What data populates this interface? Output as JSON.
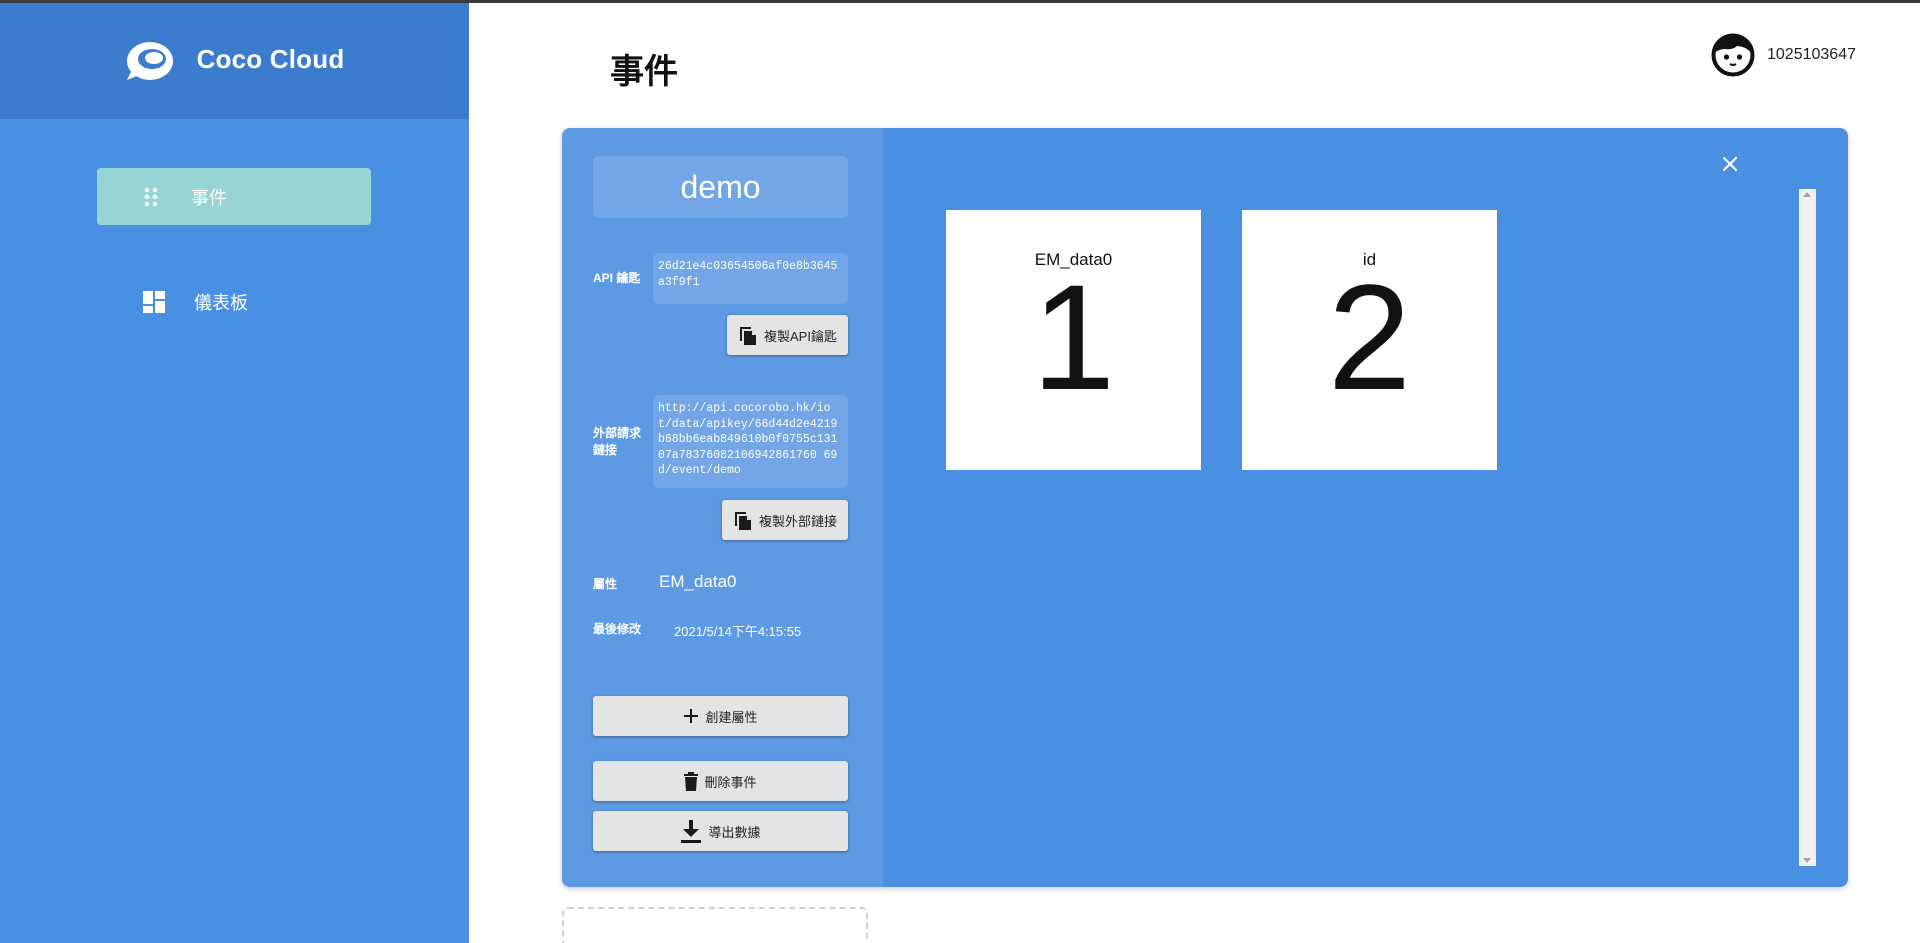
{
  "app": {
    "name": "Coco Cloud"
  },
  "sidebar": {
    "items": [
      {
        "label": "事件",
        "icon": "drag-dots-icon",
        "active": true
      },
      {
        "label": "儀表板",
        "icon": "dashboard-icon",
        "active": false
      }
    ]
  },
  "header": {
    "title": "事件",
    "user_id": "1025103647",
    "avatar_icon": "face-icon"
  },
  "event": {
    "name": "demo",
    "api_key_label": "API 鑰匙",
    "api_key": "26d21e4c03654506af0e8b3645a3f9f1",
    "copy_api_button": "複製API鑰匙",
    "external_link_label": "外部請求鏈接",
    "external_link": "http://api.cocorobo.hk/iot/data/apikey/66d44d2e4219b68bb6eab849610b0f0755c13107a78376082106942861760 69d/event/demo",
    "copy_link_button": "複製外部鏈接",
    "attribute_label": "屬性",
    "attribute_value": "EM_data0",
    "modified_label": "最後修改",
    "modified_value": "2021/5/14下午4:15:55",
    "create_attr_button": "創建屬性",
    "delete_event_button": "刪除事件",
    "export_button": "導出數據"
  },
  "tiles": [
    {
      "label": "EM_data0",
      "value": "1"
    },
    {
      "label": "id",
      "value": "2"
    }
  ],
  "colors": {
    "sidebar": "#4a90e2",
    "brand_bar": "#3b7ccc",
    "active_item": "#96d5d3",
    "card": "#4a90e2",
    "panel": "#5e9ae3",
    "field": "#72a6e6"
  }
}
